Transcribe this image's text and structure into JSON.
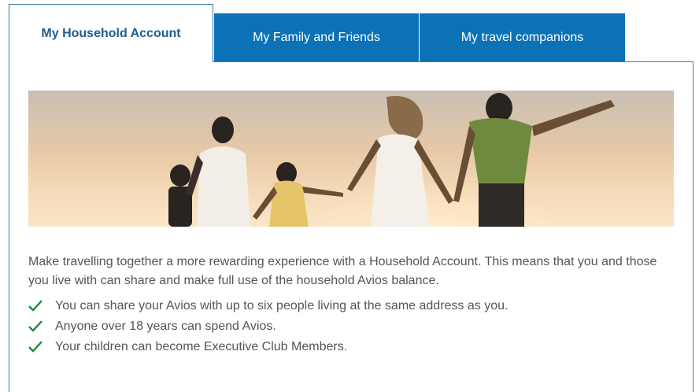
{
  "tabs": [
    {
      "label": "My Household Account",
      "active": true
    },
    {
      "label": "My Family and Friends",
      "active": false
    },
    {
      "label": "My travel companions",
      "active": false
    }
  ],
  "hero": {
    "description": "family-silhouette-sunset-photo"
  },
  "intro_text": "Make travelling together a more rewarding experience with a Household Account. This means that you and those you live with can share and make full use of the household Avios balance.",
  "benefits": [
    "You can share your Avios with up to six people living at the same address as you.",
    "Anyone over 18 years can spend Avios.",
    "Your children can become Executive Club Members."
  ],
  "colors": {
    "tab_blue": "#0b72b8",
    "active_tab_text": "#1d5e8f",
    "border": "#3b7bb0",
    "check_green": "#1a8a3a",
    "body_text": "#555555"
  },
  "icons": {
    "benefit_bullet": "check-icon"
  }
}
